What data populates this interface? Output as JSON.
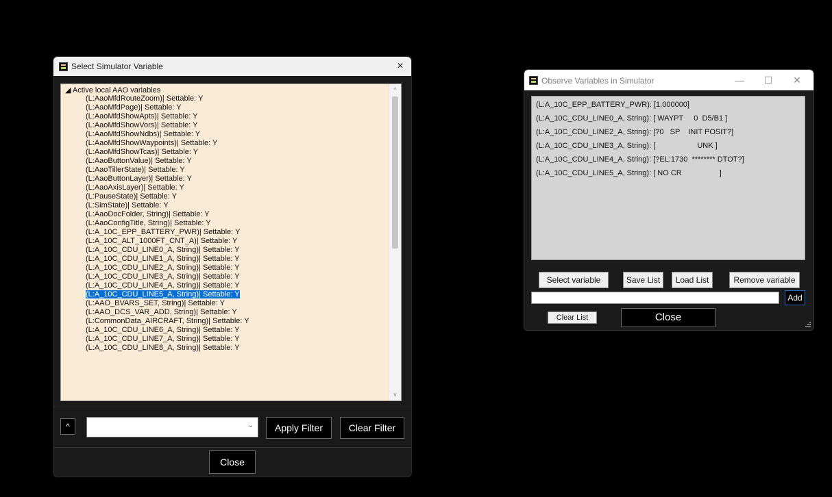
{
  "select_window": {
    "title": "Select Simulator Variable",
    "close_glyph": "×",
    "tree_root": "◢ Active local AAO variables",
    "items": [
      "(L:AaoMfdRouteZoom)| Settable: Y",
      "(L:AaoMfdPage)| Settable: Y",
      "(L:AaoMfdShowApts)| Settable: Y",
      "(L:AaoMfdShowVors)| Settable: Y",
      "(L:AaoMfdShowNdbs)| Settable: Y",
      "(L:AaoMfdShowWaypoints)| Settable: Y",
      "(L:AaoMfdShowTcas)| Settable: Y",
      "(L:AaoButtonValue)| Settable: Y",
      "(L:AaoTillerState)| Settable: Y",
      "(L:AaoButtonLayer)| Settable: Y",
      "(L:AaoAxisLayer)| Settable: Y",
      "(L:PauseState)| Settable: Y",
      "(L:SimState)| Settable: Y",
      "(L:AaoDocFolder, String)| Settable: Y",
      "(L:AaoConfigTitle, String)| Settable: Y",
      "(L:A_10C_EPP_BATTERY_PWR)| Settable: Y",
      "(L:A_10C_ALT_1000FT_CNT_A)| Settable: Y",
      "(L:A_10C_CDU_LINE0_A, String)| Settable: Y",
      "(L:A_10C_CDU_LINE1_A, String)| Settable: Y",
      "(L:A_10C_CDU_LINE2_A, String)| Settable: Y",
      "(L:A_10C_CDU_LINE3_A, String)| Settable: Y",
      "(L:A_10C_CDU_LINE4_A, String)| Settable: Y",
      "(L:A_10C_CDU_LINE5_A, String)| Settable: Y",
      "(L:AAO_BVARS_SET, String)| Settable: Y",
      "(L:AAO_DCS_VAR_ADD, String)| Settable: Y",
      "(L:CommonData_AIRCRAFT, String)| Settable: Y",
      "(L:A_10C_CDU_LINE6_A, String)| Settable: Y",
      "(L:A_10C_CDU_LINE7_A, String)| Settable: Y",
      "(L:A_10C_CDU_LINE8_A, String)| Settable: Y"
    ],
    "selected_index": 22,
    "scroll_up_glyph": "^",
    "scroll_down_glyph": "v",
    "up_button": "^",
    "filter_value": "",
    "combo_arrow": "⌄",
    "apply_filter": "Apply Filter",
    "clear_filter": "Clear Filter",
    "close": "Close"
  },
  "observe_window": {
    "title": "Observe Variables in Simulator",
    "minimize_glyph": "—",
    "maximize_glyph": "☐",
    "close_glyph": "✕",
    "lines": [
      "(L:A_10C_EPP_BATTERY_PWR): [1,000000]",
      "(L:A_10C_CDU_LINE0_A, String): [ WAYPT     0  D5/B1 ]",
      "(L:A_10C_CDU_LINE2_A, String): [?0   SP    INIT POSIT?]",
      "(L:A_10C_CDU_LINE3_A, String): [                    UNK ]",
      "(L:A_10C_CDU_LINE4_A, String): [?EL:1730  ******** DTOT?]",
      "(L:A_10C_CDU_LINE5_A, String): [ NO CR                  ]"
    ],
    "select_variable": "Select variable",
    "save_list": "Save List",
    "load_list": "Load List",
    "remove_variable": "Remove variable",
    "add_value": "",
    "add": "Add",
    "clear_list": "Clear List",
    "close": "Close"
  }
}
